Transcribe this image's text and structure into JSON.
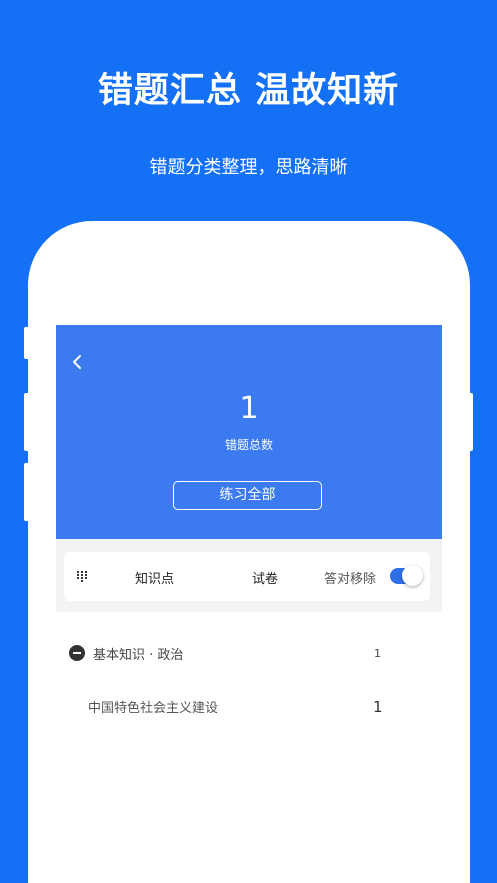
{
  "promo": {
    "headline": "错题汇总 温故知新",
    "subline": "错题分类整理，思路清晰"
  },
  "colors": {
    "background": "#1470F5",
    "hero": "#3C7BEF",
    "toggle_on": "#2F6FE8"
  },
  "summary": {
    "count": "1",
    "label": "错题总数",
    "practice_button": "练习全部"
  },
  "filter": {
    "tab_knowledge": "知识点",
    "tab_paper": "试卷",
    "remove_label": "答对移除",
    "remove_enabled": true
  },
  "list": {
    "category": {
      "label": "基本知识 · 政治",
      "count": "1",
      "expanded": true
    },
    "items": [
      {
        "label": "中国特色社会主义建设",
        "count": "1"
      }
    ]
  },
  "icons": {
    "back": "chevron-left-icon",
    "grid": "grid-dots-icon",
    "collapse": "minus-circle-icon"
  }
}
